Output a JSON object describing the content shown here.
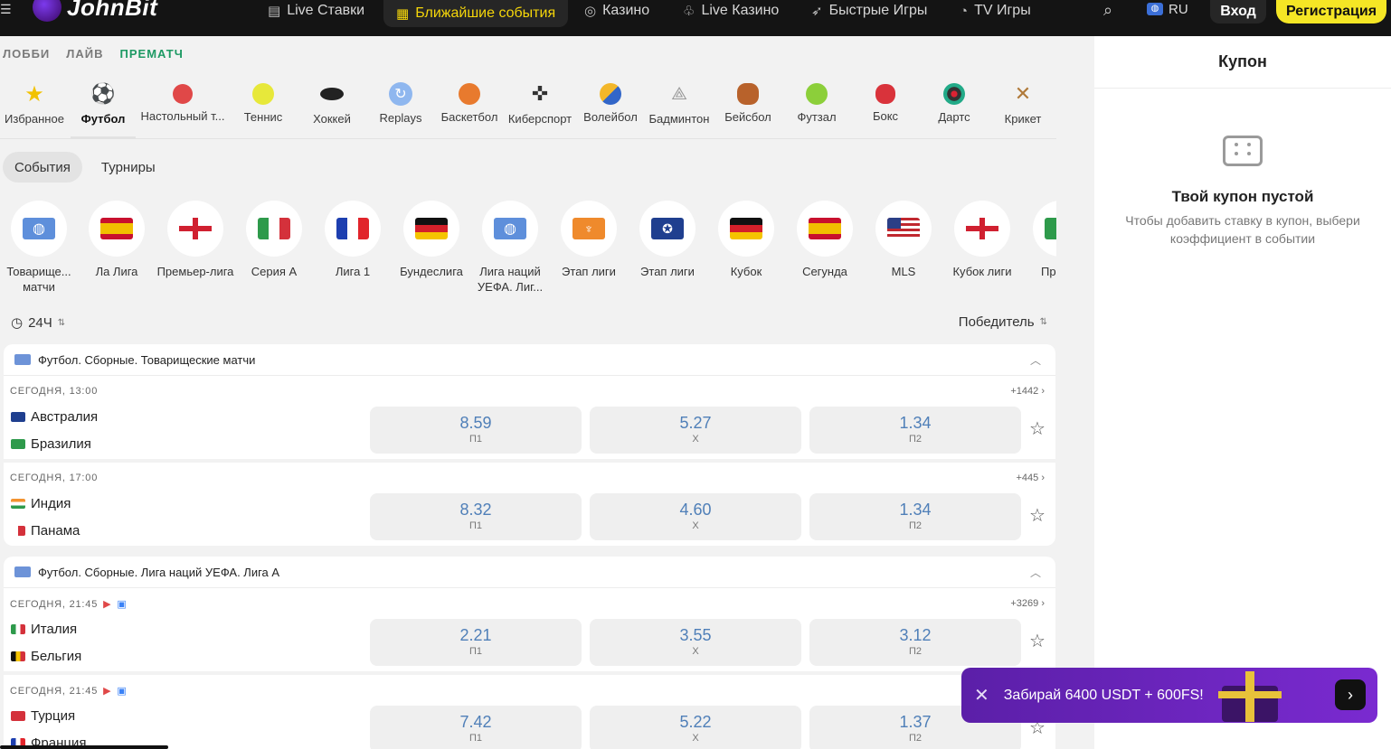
{
  "header": {
    "logo_text": "JohnBit",
    "nav": [
      {
        "label": "Live Ставки",
        "icon": "live-bets-icon"
      },
      {
        "label": "Ближайшие события",
        "icon": "calendar-icon",
        "active": true
      },
      {
        "label": "Казино",
        "icon": "casino-chip-icon"
      },
      {
        "label": "Live Казино",
        "icon": "live-casino-icon"
      },
      {
        "label": "Быстрые Игры",
        "icon": "rocket-icon"
      },
      {
        "label": "TV Игры",
        "icon": "tv-games-icon"
      }
    ],
    "lang": "RU",
    "login": "Вход",
    "register": "Регистрация"
  },
  "breadcrumbs": [
    "ЛОББИ",
    "ЛАЙВ",
    "ПРЕМАТЧ"
  ],
  "sports": [
    {
      "label": "Избранное",
      "icon": "star-icon"
    },
    {
      "label": "Футбол",
      "icon": "football-icon"
    },
    {
      "label": "Настольный т...",
      "icon": "table-tennis-icon"
    },
    {
      "label": "Теннис",
      "icon": "tennis-icon"
    },
    {
      "label": "Хоккей",
      "icon": "hockey-puck-icon"
    },
    {
      "label": "Replays",
      "icon": "replay-icon"
    },
    {
      "label": "Баскетбол",
      "icon": "basketball-icon"
    },
    {
      "label": "Киберспорт",
      "icon": "gamepad-icon"
    },
    {
      "label": "Волейбол",
      "icon": "volleyball-icon"
    },
    {
      "label": "Бадминтон",
      "icon": "shuttlecock-icon"
    },
    {
      "label": "Бейсбол",
      "icon": "baseball-glove-icon"
    },
    {
      "label": "Футзал",
      "icon": "futsal-icon"
    },
    {
      "label": "Бокс",
      "icon": "boxing-glove-icon"
    },
    {
      "label": "Дартс",
      "icon": "darts-icon"
    },
    {
      "label": "Крикет",
      "icon": "cricket-icon"
    }
  ],
  "event_tabs": [
    "События",
    "Турниры"
  ],
  "leagues": [
    {
      "label": "Товарище... матчи",
      "icon": "globe-icon"
    },
    {
      "label": "Ла Лига",
      "icon": "spain-flag"
    },
    {
      "label": "Премьер-лига",
      "icon": "england-flag"
    },
    {
      "label": "Серия А",
      "icon": "italy-flag"
    },
    {
      "label": "Лига 1",
      "icon": "france-flag"
    },
    {
      "label": "Бундеслига",
      "icon": "germany-flag"
    },
    {
      "label": "Лига наций УЕФА. Лиг...",
      "icon": "globe-icon"
    },
    {
      "label": "Этап лиги",
      "icon": "europa-league-icon"
    },
    {
      "label": "Этап лиги",
      "icon": "champions-league-icon"
    },
    {
      "label": "Кубок",
      "icon": "germany-flag"
    },
    {
      "label": "Сегунда",
      "icon": "spain-flag"
    },
    {
      "label": "MLS",
      "icon": "usa-flag"
    },
    {
      "label": "Кубок лиги",
      "icon": "england-flag"
    },
    {
      "label": "Прим л",
      "icon": "partial-flag"
    }
  ],
  "filters": {
    "time": "24Ч",
    "market": "Победитель"
  },
  "groups": [
    {
      "title": "Футбол. Сборные. Товарищеские матчи",
      "matches": [
        {
          "time": "СЕГОДНЯ, 13:00",
          "count": "+1442",
          "home": "Австралия",
          "away": "Бразилия",
          "odds": [
            {
              "v": "8.59",
              "l": "П1"
            },
            {
              "v": "5.27",
              "l": "Х"
            },
            {
              "v": "1.34",
              "l": "П2"
            }
          ]
        },
        {
          "time": "СЕГОДНЯ, 17:00",
          "count": "+445",
          "home": "Индия",
          "away": "Панама",
          "odds": [
            {
              "v": "8.32",
              "l": "П1"
            },
            {
              "v": "4.60",
              "l": "Х"
            },
            {
              "v": "1.34",
              "l": "П2"
            }
          ]
        }
      ]
    },
    {
      "title": "Футбол. Сборные. Лига наций УЕФА. Лига А",
      "matches": [
        {
          "time": "СЕГОДНЯ, 21:45",
          "count": "+3269",
          "home": "Италия",
          "away": "Бельгия",
          "odds": [
            {
              "v": "2.21",
              "l": "П1"
            },
            {
              "v": "3.55",
              "l": "Х"
            },
            {
              "v": "3.12",
              "l": "П2"
            }
          ]
        },
        {
          "time": "СЕГОДНЯ, 21:45",
          "count": "",
          "home": "Турция",
          "away": "Франция",
          "odds": [
            {
              "v": "7.42",
              "l": "П1"
            },
            {
              "v": "5.22",
              "l": "Х"
            },
            {
              "v": "1.37",
              "l": "П2"
            }
          ]
        }
      ]
    }
  ],
  "coupon": {
    "title": "Купон",
    "empty_title": "Твой купон пустой",
    "empty_hint": "Чтобы добавить ставку в купон, выбери коэффициент в событии"
  },
  "promo": {
    "text": "Забирай 6400 USDT + 600FS!"
  },
  "colors": {
    "accent": "#f5e625",
    "active_nav": "#f5d60a",
    "prematch": "#1e9a64",
    "odds": "#4f7fb8",
    "promo": "#6a24bd"
  }
}
